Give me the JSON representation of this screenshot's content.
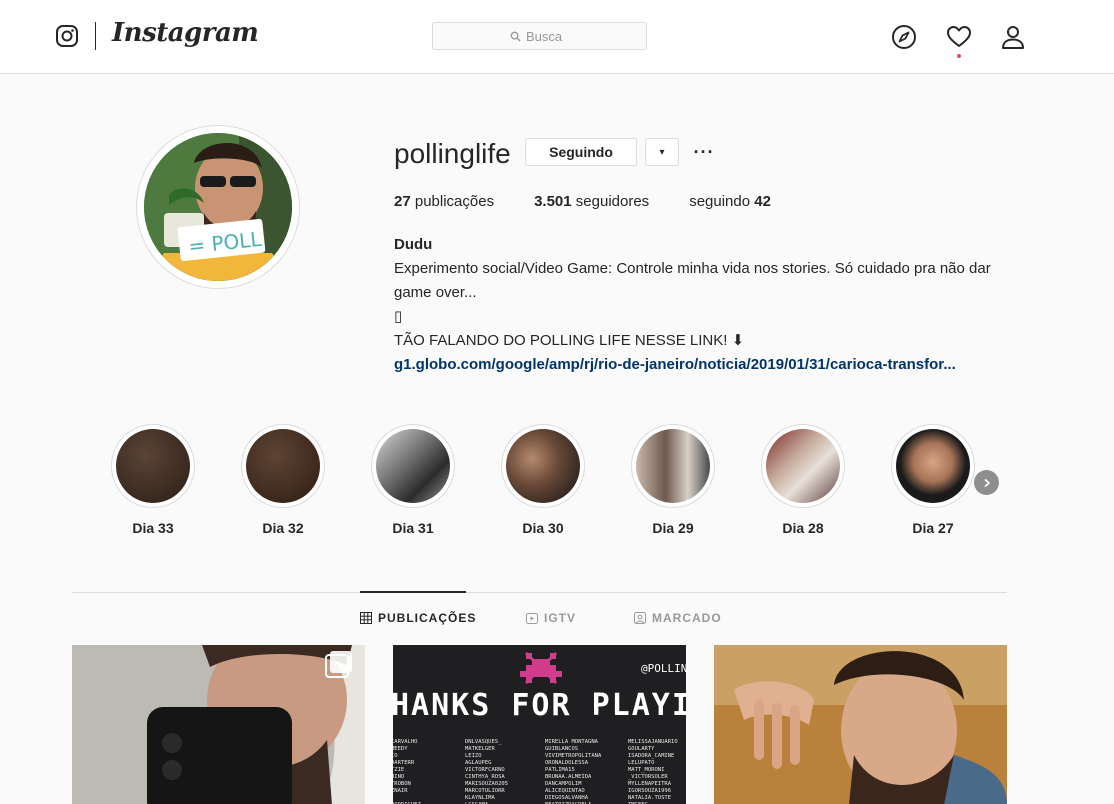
{
  "header": {
    "wordmark": "Instagram",
    "search_placeholder": "Busca",
    "icons": [
      "instagram-glyph-icon",
      "compass-icon",
      "heart-icon",
      "user-icon",
      "search-icon"
    ]
  },
  "profile": {
    "username": "pollinglife",
    "follow_button_label": "Seguindo",
    "dropdown_label": "▾",
    "more_label": "···",
    "stats": {
      "posts_count": "27",
      "posts_label": "publicações",
      "followers_count": "3.501",
      "followers_label": "seguidores",
      "following_label": "seguindo",
      "following_count": "42"
    },
    "bio": {
      "name": "Dudu",
      "line1": "Experimento social/Video Game: Controle minha vida nos stories. Só cuidado pra não dar game over...",
      "line2": "▯",
      "line3": "TÃO FALANDO DO POLLING LIFE NESSE LINK! ⬇",
      "link": "g1.globo.com/google/amp/rj/rio-de-janeiro/noticia/2019/01/31/carioca-transfor..."
    },
    "avatar_sticker": "= POLL"
  },
  "highlights": [
    {
      "label": "Dia 33",
      "color": "#3a2a22"
    },
    {
      "label": "Dia 32",
      "color": "#3d2a1f"
    },
    {
      "label": "Dia 31",
      "color": "#555555"
    },
    {
      "label": "Dia 30",
      "color": "#7a5a48"
    },
    {
      "label": "Dia 29",
      "color": "#9a8a80"
    },
    {
      "label": "Dia 28",
      "color": "#8a6a60"
    },
    {
      "label": "Dia 27",
      "color": "#2a2a2a"
    }
  ],
  "tabs": [
    {
      "label": "PUBLICAÇÕES",
      "active": true
    },
    {
      "label": "IGTV",
      "active": false
    },
    {
      "label": "MARCADO",
      "active": false
    }
  ],
  "posts": {
    "post2_handle": "@POLLIN",
    "post2_title": "HANKS FOR PLAYIN",
    "post2_names": [
      [
        "CARVALHO",
        "DNLVASQUES_",
        "MIRELLA MONTAGNA",
        "MELISSAJANUARIO"
      ],
      [
        "MEEDY",
        "MATKELGER",
        "GUIBLANCOS",
        "GOULARTY"
      ],
      [
        "IO",
        "LEIZO",
        "VIVIMETROPOLITANA",
        "ISADORA_CAMINE"
      ],
      [
        "DARTERR",
        "AGLAUPEG",
        "ORONALDOLESSA",
        "LELUPATO"
      ],
      [
        "TZIE",
        "VICTORFCARNO",
        "PATLIMA15",
        "MATT_MORONI"
      ],
      [
        "BINO",
        "CINTHYA_ROSA",
        "BRUNAA.ALMEIDA",
        "_VICTORSOLER"
      ],
      [
        "TROBON",
        "MARISOUZA0205",
        "DANCAMPOLIM",
        "MYLLENAPEITRA"
      ],
      [
        "ZNAIR",
        "MARCOTULIORR",
        "ALICEQUINTAO",
        "IGORSOUZA1996"
      ],
      [
        "",
        "KLAYNLIMA",
        "DIEGOSALVANHA",
        "NATALIA.TOSTE"
      ],
      [
        "RODRIGUEZ",
        "LCSGAMA",
        "BEATRIZDAGRELA",
        "TMCFEC"
      ]
    ],
    "colors": {
      "accent": "#ed4956",
      "link": "#003569",
      "border": "#dbdbdb"
    }
  }
}
